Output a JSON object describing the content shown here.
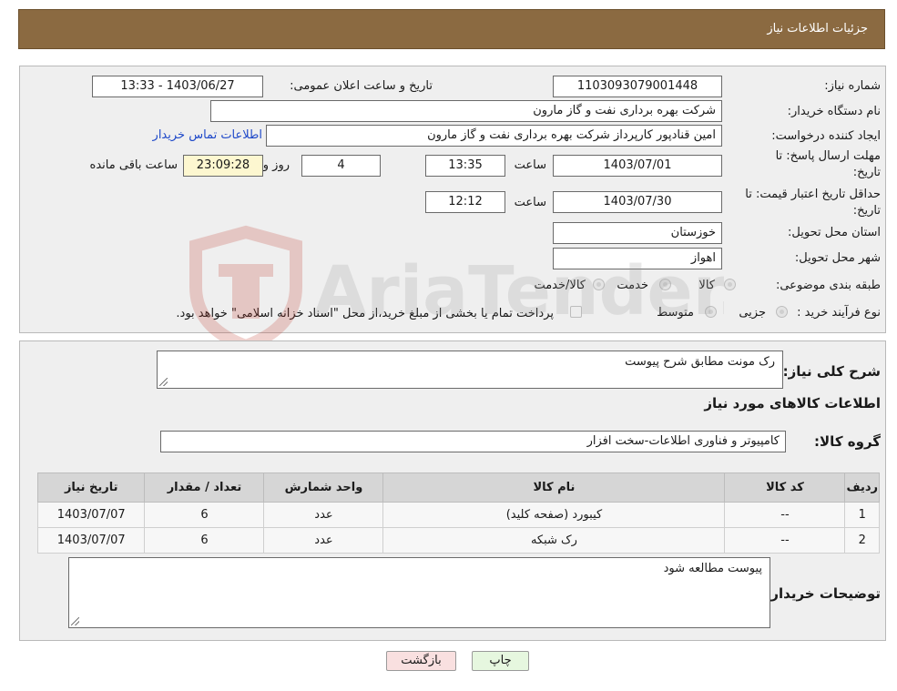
{
  "header": {
    "title": "جزئیات اطلاعات نیاز"
  },
  "details": {
    "need_number_label": "شماره نیاز:",
    "need_number_value": "1103093079001448",
    "announce_label": "تاریخ و ساعت اعلان عمومی:",
    "announce_value": "1403/06/27 - 13:33",
    "buyer_org_label": "نام دستگاه خریدار:",
    "buyer_org_value": "شرکت بهره برداری نفت و گاز مارون",
    "creator_label": "ایجاد کننده درخواست:",
    "creator_value": "امین قنادپور کارپرداز شرکت بهره برداری نفت و گاز مارون",
    "contact_link": "اطلاعات تماس خریدار",
    "deadline_label_1": "مهلت ارسال پاسخ: تا",
    "deadline_label_2": "تاریخ:",
    "deadline_date": "1403/07/01",
    "time_label": "ساعت",
    "deadline_time": "13:35",
    "days_value": "4",
    "days_and_label": "روز و",
    "remaining_time": "23:09:28",
    "remaining_label": "ساعت باقی مانده",
    "validity_label_1": "حداقل تاریخ اعتبار قیمت: تا",
    "validity_label_2": "تاریخ:",
    "validity_date": "1403/07/30",
    "validity_time": "12:12",
    "province_label": "استان محل تحویل:",
    "province_value": "خوزستان",
    "city_label": "شهر محل تحویل:",
    "city_value": "اهواز",
    "category_label": "طبقه بندی موضوعی:",
    "category_options": [
      "کالا",
      "خدمت",
      "کالا/خدمت"
    ],
    "process_label": "نوع فرآیند خرید :",
    "process_options": [
      "جزیی",
      "متوسط"
    ],
    "payment_note": "پرداخت تمام یا بخشی از مبلغ خرید،از محل \"اسناد خزانه اسلامی\" خواهد بود."
  },
  "summary": {
    "general_label": "شرح کلی نیاز:",
    "general_value": "رک مونت مطابق شرح پیوست",
    "goods_info_title": "اطلاعات کالاهای مورد نیاز",
    "goods_group_label": "گروه کالا:",
    "goods_group_value": "کامپیوتر و فناوری اطلاعات-سخت افزار",
    "table": {
      "headers": [
        "ردیف",
        "کد کالا",
        "نام کالا",
        "واحد شمارش",
        "تعداد / مقدار",
        "تاریخ نیاز"
      ],
      "rows": [
        [
          "1",
          "--",
          "کیبورد (صفحه کلید)",
          "عدد",
          "6",
          "1403/07/07"
        ],
        [
          "2",
          "--",
          "رک شبکه",
          "عدد",
          "6",
          "1403/07/07"
        ]
      ]
    },
    "buyer_notes_label": "توضیحات خریدار:",
    "buyer_notes_value": "پیوست مطالعه شود"
  },
  "buttons": {
    "print": "چاپ",
    "back": "بازگشت"
  },
  "watermark": {
    "text": "AriaTender.neT"
  },
  "colors": {
    "header": "#8b6a41",
    "panel": "#efefef",
    "link": "#1f49c9",
    "print_btn": "#e6f7df",
    "back_btn": "#f9e0e0"
  }
}
